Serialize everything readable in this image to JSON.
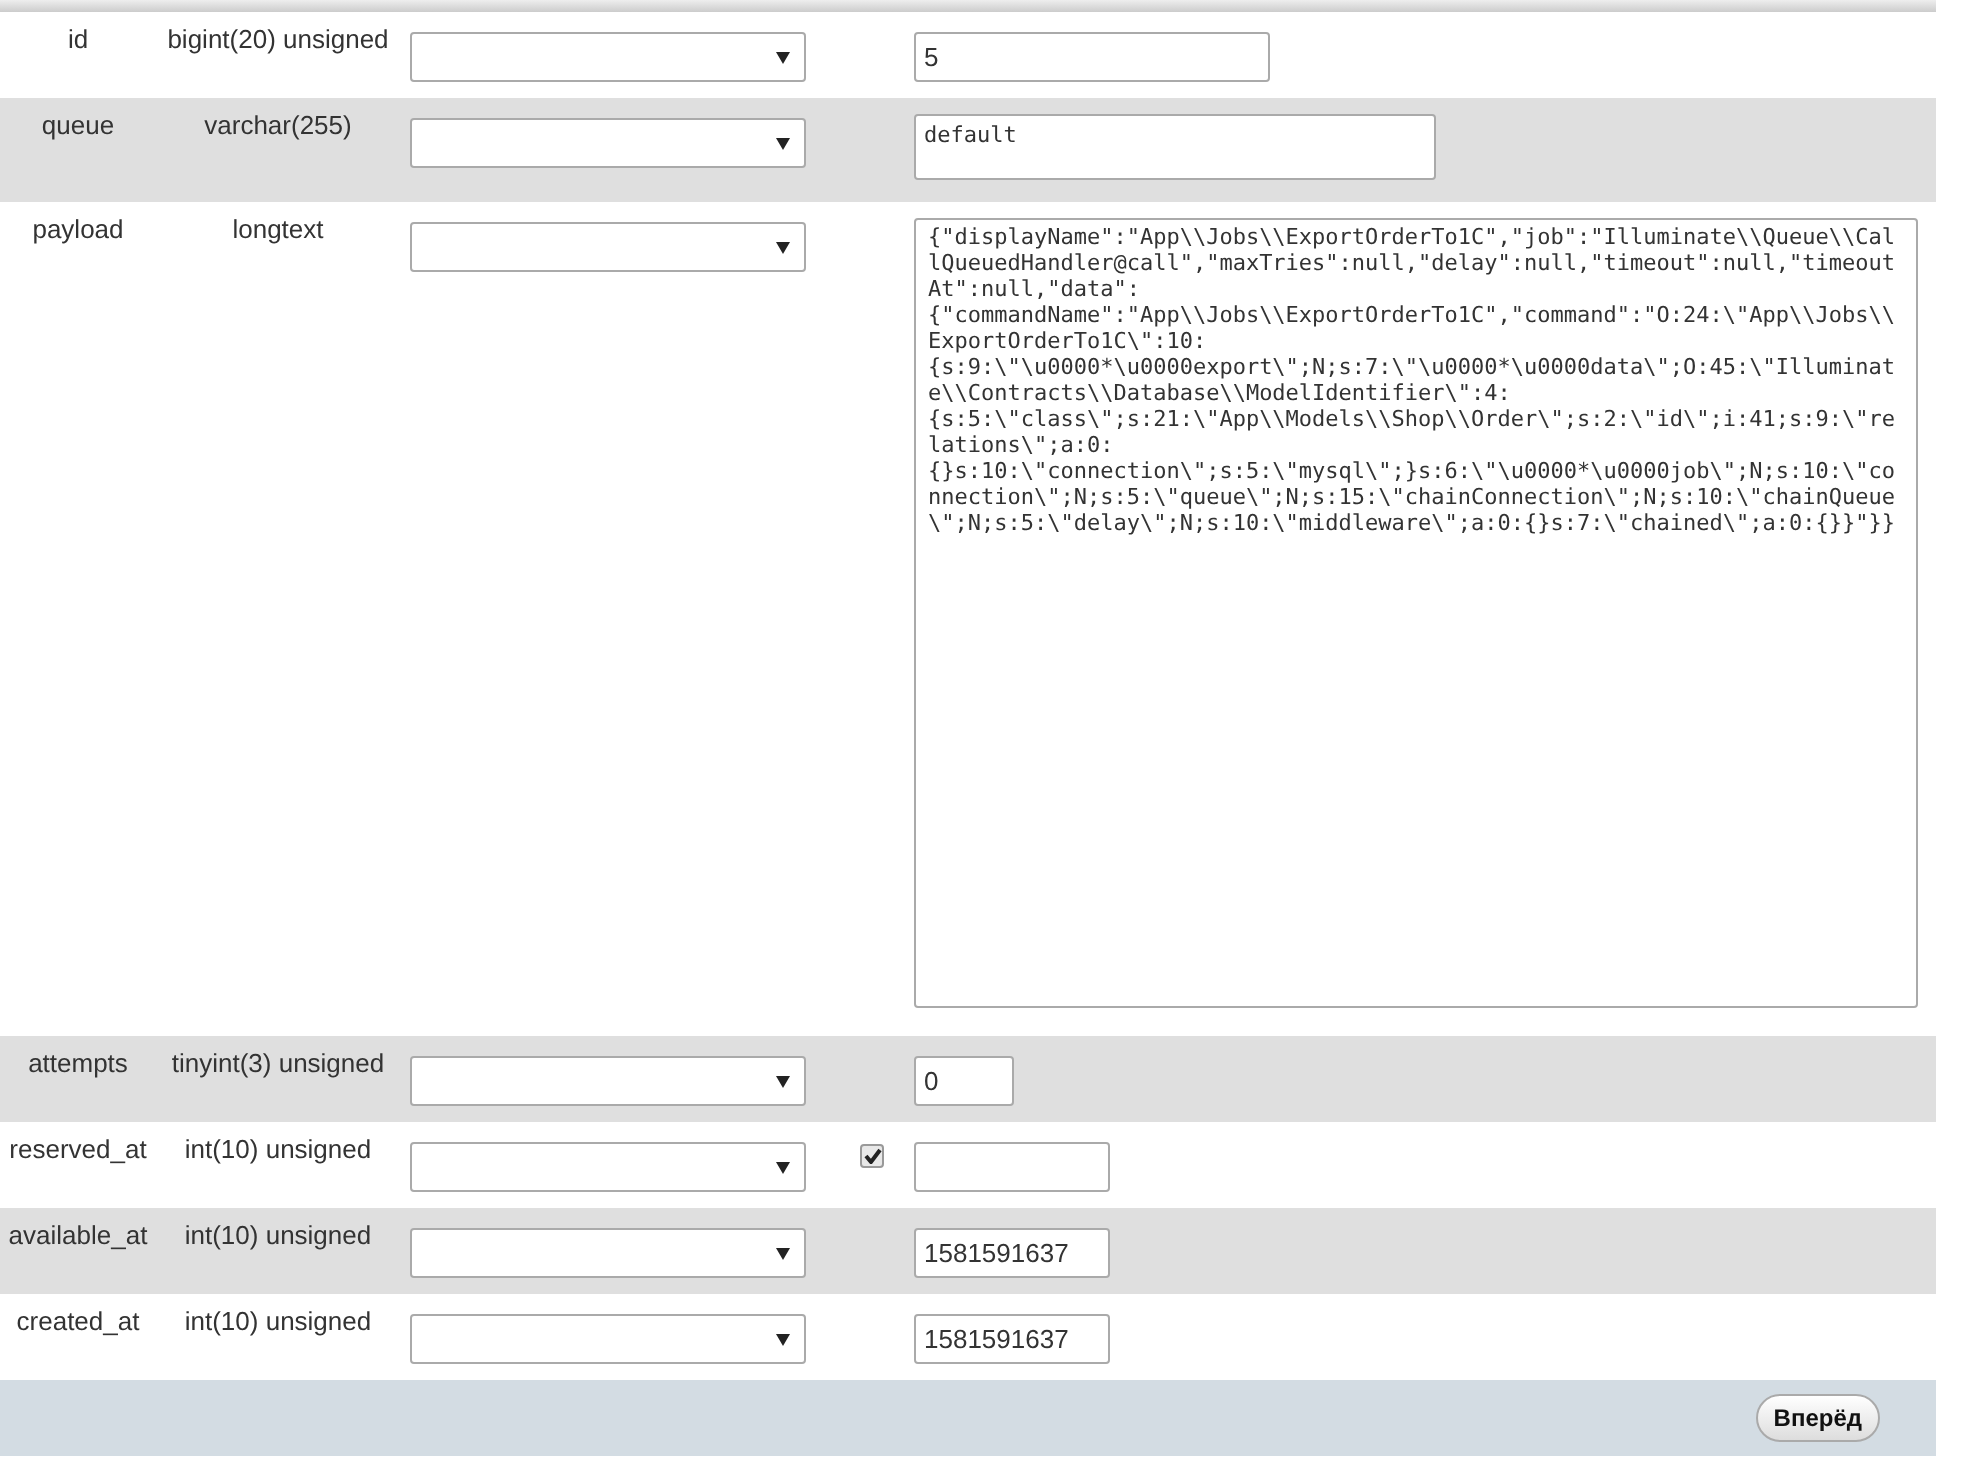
{
  "rows": [
    {
      "column": "id",
      "type": "bigint(20) unsigned",
      "value": "5",
      "kind": "short"
    },
    {
      "column": "queue",
      "type": "varchar(255)",
      "value": "default",
      "kind": "textarea_small"
    },
    {
      "column": "payload",
      "type": "longtext",
      "value": "{\"displayName\":\"App\\\\Jobs\\\\ExportOrderTo1C\",\"job\":\"Illuminate\\\\Queue\\\\CallQueuedHandler@call\",\"maxTries\":null,\"delay\":null,\"timeout\":null,\"timeoutAt\":null,\"data\":{\"commandName\":\"App\\\\Jobs\\\\ExportOrderTo1C\",\"command\":\"O:24:\\\"App\\\\Jobs\\\\ExportOrderTo1C\\\":10:{s:9:\\\"\\u0000*\\u0000export\\\";N;s:7:\\\"\\u0000*\\u0000data\\\";O:45:\\\"Illuminate\\\\Contracts\\\\Database\\\\ModelIdentifier\\\":4:{s:5:\\\"class\\\";s:21:\\\"App\\\\Models\\\\Shop\\\\Order\\\";s:2:\\\"id\\\";i:41;s:9:\\\"relations\\\";a:0:{}s:10:\\\"connection\\\";s:5:\\\"mysql\\\";}s:6:\\\"\\u0000*\\u0000job\\\";N;s:10:\\\"connection\\\";N;s:5:\\\"queue\\\";N;s:15:\\\"chainConnection\\\";N;s:10:\\\"chainQueue\\\";N;s:5:\\\"delay\\\";N;s:10:\\\"middleware\\\";a:0:{}s:7:\\\"chained\\\";a:0:{}}\"}}",
      "kind": "textarea_large"
    },
    {
      "column": "attempts",
      "type": "tinyint(3) unsigned",
      "value": "0",
      "kind": "tiny"
    },
    {
      "column": "reserved_at",
      "type": "int(10) unsigned",
      "value": "",
      "kind": "medium",
      "null_checked": true
    },
    {
      "column": "available_at",
      "type": "int(10) unsigned",
      "value": "1581591637",
      "kind": "medium"
    },
    {
      "column": "created_at",
      "type": "int(10) unsigned",
      "value": "1581591637",
      "kind": "medium"
    }
  ],
  "footer": {
    "button": "Вперёд"
  }
}
